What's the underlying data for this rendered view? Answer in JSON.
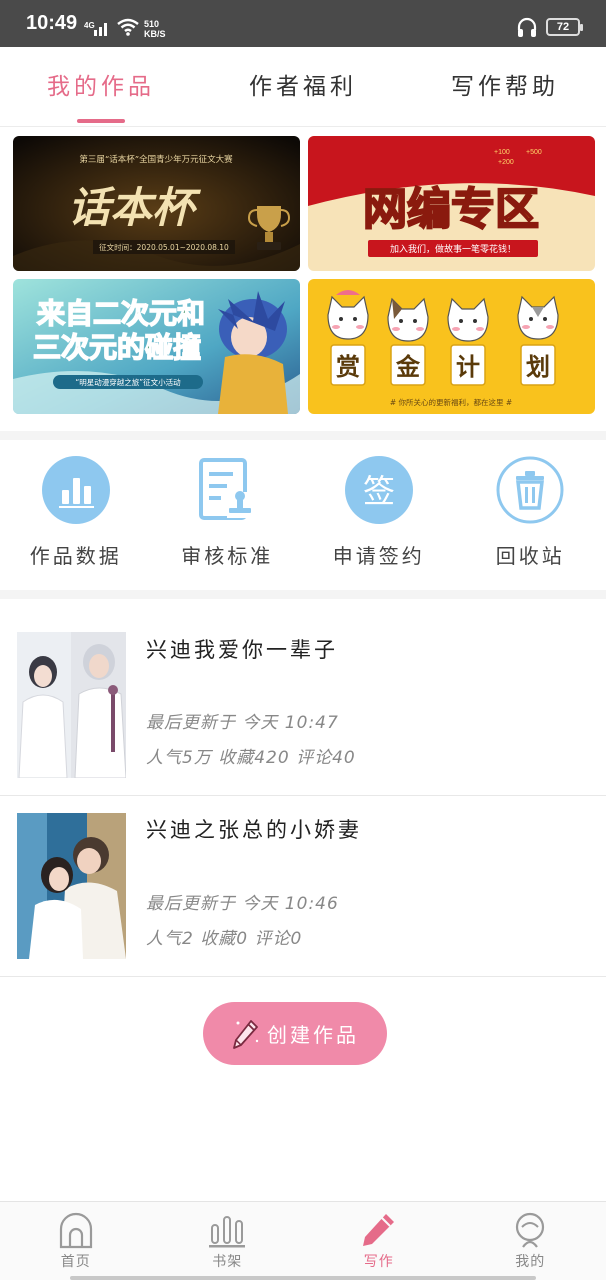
{
  "status_bar": {
    "time": "10:49",
    "network": "4G",
    "speed_value": "510",
    "speed_unit": "KB/S",
    "battery": "72"
  },
  "top_tabs": [
    {
      "label": "我的作品",
      "active": true
    },
    {
      "label": "作者福利",
      "active": false
    },
    {
      "label": "写作帮助",
      "active": false
    }
  ],
  "banners": [
    {
      "title": "话本杯",
      "subtitle": "第三届“话本杯”全国青少年万元征文大赛",
      "caption": "征文时间：2020.05.01~2020.08.10"
    },
    {
      "title": "网编专区",
      "subtitle": "加入我们，做故事一笔零花钱！",
      "bonus_1": "+100",
      "bonus_2": "+500",
      "bonus_3": "+200"
    },
    {
      "title_line1": "来自二次元和",
      "title_line2": "三次元的碰撞",
      "caption": "“明星动漫穿越之旅”征文小活动"
    },
    {
      "chars": [
        "赏",
        "金",
        "计",
        "划"
      ],
      "caption": "# 你所关心的更新福利，都在这里 #"
    }
  ],
  "tools": [
    {
      "label": "作品数据",
      "icon": "bar-chart-icon"
    },
    {
      "label": "审核标准",
      "icon": "document-stamp-icon"
    },
    {
      "label": "申请签约",
      "icon": "sign-icon",
      "icon_text": "签"
    },
    {
      "label": "回收站",
      "icon": "trash-icon"
    }
  ],
  "works": [
    {
      "title": "兴迪我爱你一辈子",
      "updated": "最后更新于 今天 10:47",
      "stats": "人气5万 收藏420 评论40"
    },
    {
      "title": "兴迪之张总的小娇妻",
      "updated": "最后更新于 今天 10:46",
      "stats": "人气2 收藏0 评论0"
    }
  ],
  "create_button": {
    "label": "创建作品"
  },
  "bottom_nav": [
    {
      "label": "首页",
      "icon": "home-icon",
      "active": false
    },
    {
      "label": "书架",
      "icon": "bookshelf-icon",
      "active": false
    },
    {
      "label": "写作",
      "icon": "pen-icon",
      "active": true
    },
    {
      "label": "我的",
      "icon": "profile-icon",
      "active": false
    }
  ],
  "colors": {
    "accent": "#e56b89",
    "button": "#f08aa9",
    "tool_blue": "#8ec8ef",
    "status_bar": "#4a4a4a"
  }
}
